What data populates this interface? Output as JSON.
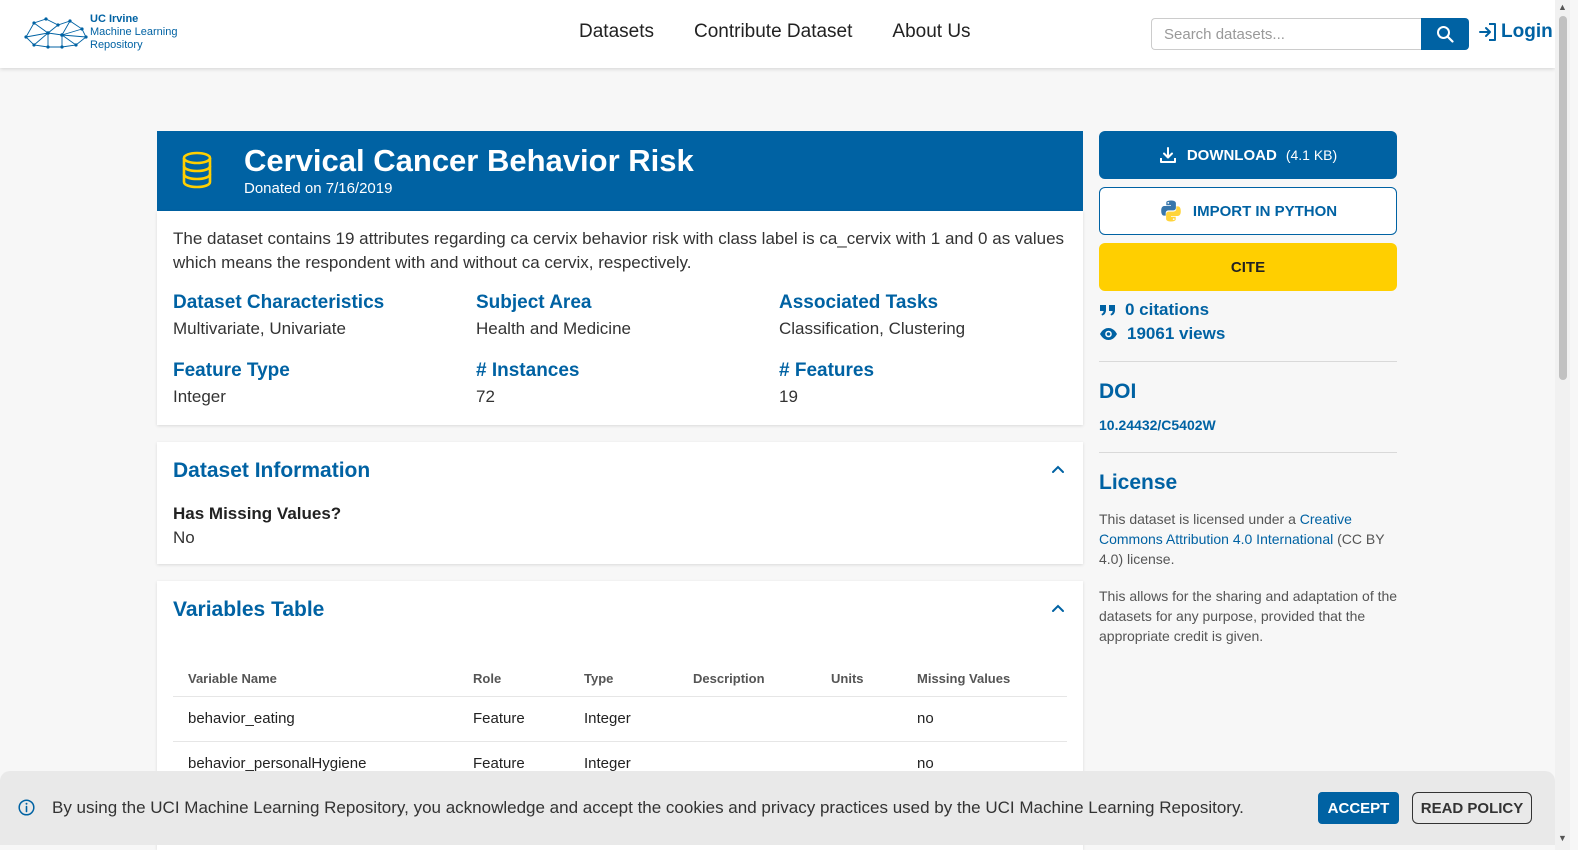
{
  "brand": {
    "line1": "UC Irvine",
    "line2": "Machine Learning",
    "line3": "Repository"
  },
  "nav": {
    "datasets": "Datasets",
    "contribute": "Contribute Dataset",
    "about": "About Us"
  },
  "search": {
    "placeholder": "Search datasets..."
  },
  "login": {
    "label": "Login"
  },
  "dataset": {
    "title": "Cervical Cancer Behavior Risk",
    "donated": "Donated on 7/16/2019",
    "description": "The dataset contains 19 attributes regarding ca cervix behavior risk with class label is ca_cervix with 1 and 0 as values which means the respondent with and without ca cervix, respectively.",
    "attributes": [
      {
        "label": "Dataset Characteristics",
        "value": "Multivariate, Univariate"
      },
      {
        "label": "Subject Area",
        "value": "Health and Medicine"
      },
      {
        "label": "Associated Tasks",
        "value": "Classification, Clustering"
      },
      {
        "label": "Feature Type",
        "value": "Integer"
      },
      {
        "label": "# Instances",
        "value": "72"
      },
      {
        "label": "# Features",
        "value": "19"
      }
    ]
  },
  "info": {
    "title": "Dataset Information",
    "question": "Has Missing Values?",
    "answer": "No"
  },
  "variables": {
    "title": "Variables Table",
    "columns": [
      "Variable Name",
      "Role",
      "Type",
      "Description",
      "Units",
      "Missing Values"
    ],
    "rows": [
      [
        "behavior_eating",
        "Feature",
        "Integer",
        "",
        "",
        "no"
      ],
      [
        "behavior_personalHygiene",
        "Feature",
        "Integer",
        "",
        "",
        "no"
      ]
    ]
  },
  "sidebar": {
    "download_label": "DOWNLOAD",
    "download_size": "(4.1 KB)",
    "python_label": "IMPORT IN PYTHON",
    "cite_label": "CITE",
    "citations": "0 citations",
    "views": "19061 views",
    "doi_heading": "DOI",
    "doi": "10.24432/C5402W",
    "license_heading": "License",
    "license_pre": "This dataset is licensed under a ",
    "license_link": "Creative Commons Attribution 4.0 International",
    "license_post": " (CC BY 4.0) license.",
    "license_note": "This allows for the sharing and adaptation of the datasets for any purpose, provided that the appropriate credit is given."
  },
  "cookie": {
    "text": "By using the UCI Machine Learning Repository, you acknowledge and accept the cookies and privacy practices used by the UCI Machine Learning Repository.",
    "accept": "ACCEPT",
    "policy": "READ POLICY"
  },
  "colors": {
    "primary": "#0062a3",
    "cite": "#ffcf00",
    "background": "#f7f7f7"
  },
  "icons": [
    "network-logo-icon",
    "search-icon",
    "login-icon",
    "database-icon",
    "download-icon",
    "python-icon",
    "quote-icon",
    "eye-icon",
    "chevron-up-icon",
    "info-icon"
  ]
}
